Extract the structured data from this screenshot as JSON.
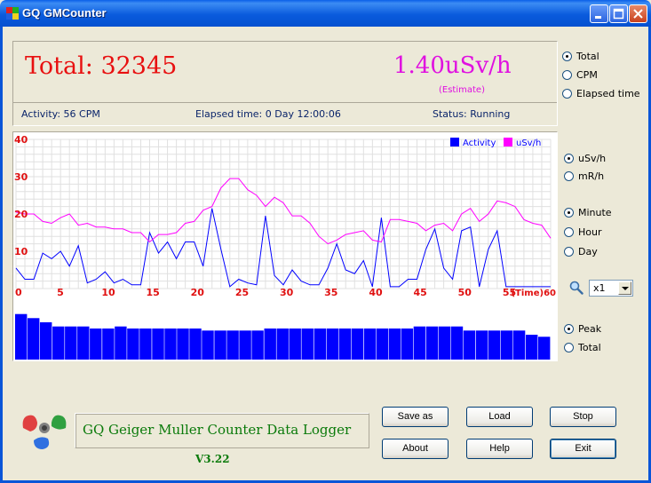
{
  "window": {
    "title": "GQ GMCounter"
  },
  "header": {
    "total_label": "Total:",
    "total_value": "32345",
    "dose_value": "1.40uSv/h",
    "estimate_note": "(Estimate)",
    "activity": "Activity: 56 CPM",
    "elapsed": "Elapsed time: 0 Day 12:00:06",
    "status": "Status: Running"
  },
  "display_mode": {
    "options": [
      "Total",
      "CPM",
      "Elapsed time"
    ],
    "selected": "Total"
  },
  "unit_mode": {
    "options": [
      "uSv/h",
      "mR/h"
    ],
    "selected": "uSv/h"
  },
  "time_mode": {
    "options": [
      "Minute",
      "Hour",
      "Day"
    ],
    "selected": "Minute"
  },
  "zoom": {
    "value": "x1"
  },
  "bar_mode": {
    "options": [
      "Peak",
      "Total"
    ],
    "selected": "Peak"
  },
  "chart_data": [
    {
      "type": "line",
      "x_ticks": [
        "0",
        "5",
        "10",
        "15",
        "20",
        "25",
        "30",
        "35",
        "40",
        "45",
        "50",
        "55"
      ],
      "x_end_label": "(Time)60",
      "y_ticks": [
        "10",
        "20",
        "30",
        "40"
      ],
      "xlim": [
        0,
        60
      ],
      "ylim": [
        0,
        40
      ],
      "grid": true,
      "legend_position": "top-right",
      "series": [
        {
          "name": "Activity",
          "color": "#0000FF",
          "values": [
            5.5,
            2.5,
            2.5,
            9.5,
            8,
            10,
            6,
            11.5,
            1.5,
            2.5,
            4.5,
            1.5,
            2.5,
            1,
            1,
            15,
            9.5,
            12.5,
            8,
            12.5,
            12.5,
            6,
            21.5,
            10.5,
            0.5,
            2.5,
            1.5,
            1,
            19.5,
            3.5,
            1,
            5,
            2,
            1,
            1,
            5.5,
            12,
            5,
            4,
            7.5,
            0.5,
            19,
            0.5,
            0.5,
            2.5,
            2.5,
            10.5,
            16,
            5.5,
            2.5,
            15.5,
            16.5,
            0.5,
            10.5,
            15.5,
            0.5,
            0.5,
            0.5,
            0.5,
            0.5,
            0.5
          ]
        },
        {
          "name": "uSv/h",
          "color": "#FF00FF",
          "values": [
            20.5,
            20,
            20,
            18,
            17.5,
            19,
            20,
            17,
            17.5,
            16.5,
            16.5,
            16,
            16,
            15,
            15,
            12.5,
            14.5,
            14.5,
            15,
            17.5,
            18,
            21,
            22,
            27,
            29.5,
            29.5,
            26.5,
            25,
            22,
            24.5,
            23,
            19.5,
            19.5,
            17.5,
            14,
            12,
            13,
            14.5,
            15,
            15.5,
            13,
            12.5,
            18.5,
            18.5,
            18,
            17.5,
            15.5,
            17,
            17.5,
            15.5,
            20,
            21.5,
            18,
            20,
            23.5,
            23,
            22,
            18.5,
            17.5,
            17,
            13.5
          ]
        }
      ]
    },
    {
      "type": "bar",
      "values": [
        11,
        10,
        9,
        8,
        8,
        8,
        7.5,
        7.5,
        8,
        7.5,
        7.5,
        7.5,
        7.5,
        7.5,
        7.5,
        7,
        7,
        7,
        7,
        7,
        7.5,
        7.5,
        7.5,
        7.5,
        7.5,
        7.5,
        7.5,
        7.5,
        7.5,
        7.5,
        7.5,
        7.5,
        8,
        8,
        8,
        8,
        7,
        7,
        7,
        7,
        7,
        6,
        5.5
      ],
      "ylim": [
        0,
        12
      ]
    }
  ],
  "logo": {
    "text": "GQ Geiger Muller Counter Data Logger",
    "version": "V3.22"
  },
  "buttons": {
    "save_as": "Save as",
    "load": "Load",
    "stop": "Stop",
    "about": "About",
    "help": "Help",
    "exit": "Exit"
  }
}
